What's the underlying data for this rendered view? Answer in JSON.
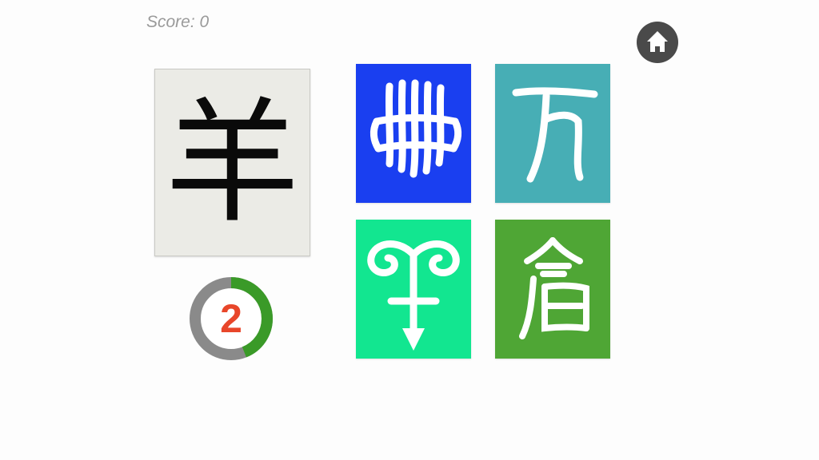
{
  "score_label": "Score: 0",
  "prompt": {
    "character": "羊"
  },
  "timer": {
    "count": "2",
    "remaining_fraction": 0.44,
    "ring_track_color": "#8a8a8a",
    "ring_fill_color": "#3a9a28",
    "number_color": "#e8462a"
  },
  "home_button": {
    "icon": "home-icon",
    "color": "#4a4a4a"
  },
  "choices": [
    {
      "id": "choice-1",
      "glyph": "ancient-script-ce",
      "background": "#1a3ff0"
    },
    {
      "id": "choice-2",
      "glyph": "ancient-script-tian",
      "background": "#47aeb5"
    },
    {
      "id": "choice-3",
      "glyph": "ancient-script-yang",
      "background": "#12e690"
    },
    {
      "id": "choice-4",
      "glyph": "ancient-script-cang",
      "background": "#4fa635"
    }
  ]
}
